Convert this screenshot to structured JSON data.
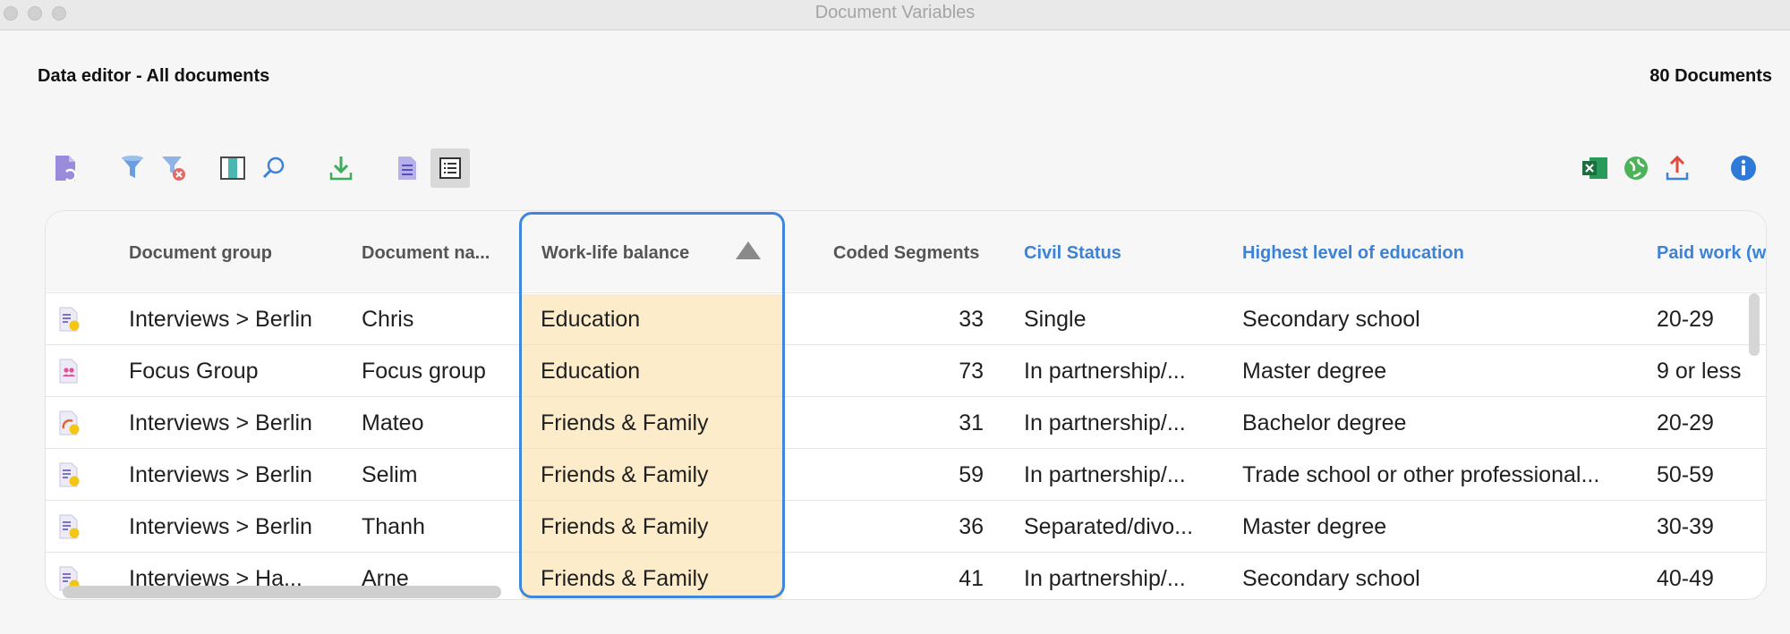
{
  "window": {
    "title": "Document Variables"
  },
  "header": {
    "title": "Data editor - All documents",
    "count": "80 Documents"
  },
  "toolbar": {
    "left": [
      "new-document-icon",
      "filter-icon",
      "clear-filter-icon",
      "columns-icon",
      "search-icon",
      "import-icon",
      "list-view-icon",
      "detail-view-icon"
    ],
    "right": [
      "excel-export-icon",
      "web-export-icon",
      "upload-export-icon",
      "info-icon"
    ]
  },
  "table": {
    "columns": {
      "doc_group": "Document group",
      "doc_name": "Document na...",
      "work_life": "Work-life balance",
      "coded": "Coded Segments",
      "civil": "Civil Status",
      "education": "Highest level of education",
      "paid_work": "Paid work (w"
    },
    "sort": {
      "column": "Work-life balance",
      "direction": "ascending"
    },
    "rows": [
      {
        "icon": "text-document-icon",
        "doc_group": "Interviews > Berlin",
        "doc_name": "Chris",
        "work_life": "Education",
        "coded": "33",
        "civil": "Single",
        "education": "Secondary school",
        "paid_work": "20-29"
      },
      {
        "icon": "focus-group-icon",
        "doc_group": "Focus Group",
        "doc_name": "Focus group",
        "work_life": "Education",
        "coded": "73",
        "civil": "In partnership/...",
        "education": "Master degree",
        "paid_work": "9 or less"
      },
      {
        "icon": "media-document-icon",
        "doc_group": "Interviews > Berlin",
        "doc_name": "Mateo",
        "work_life": "Friends & Family",
        "coded": "31",
        "civil": "In partnership/...",
        "education": "Bachelor degree",
        "paid_work": "20-29"
      },
      {
        "icon": "text-document-icon",
        "doc_group": "Interviews > Berlin",
        "doc_name": "Selim",
        "work_life": "Friends & Family",
        "coded": "59",
        "civil": "In partnership/...",
        "education": "Trade school or other professional...",
        "paid_work": "50-59"
      },
      {
        "icon": "text-document-icon",
        "doc_group": "Interviews > Berlin",
        "doc_name": "Thanh",
        "work_life": "Friends & Family",
        "coded": "36",
        "civil": "Separated/divo...",
        "education": "Master degree",
        "paid_work": "30-39"
      },
      {
        "icon": "text-document-icon",
        "doc_group": "Interviews > Ha...",
        "doc_name": "Arne",
        "work_life": "Friends & Family",
        "coded": "41",
        "civil": "In partnership/...",
        "education": "Secondary school",
        "paid_work": "40-49"
      }
    ]
  },
  "colors": {
    "accent": "#3f86de",
    "highlight": "#fdecca",
    "header_blue": "#3d82d6"
  }
}
